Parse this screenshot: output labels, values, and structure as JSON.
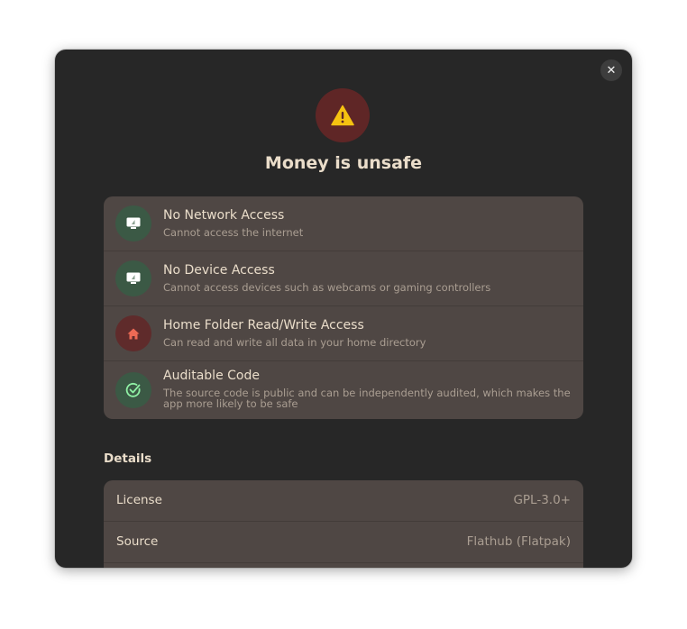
{
  "dialog": {
    "title": "Money is unsafe",
    "close_icon": "close-icon",
    "hero_icon": "warning-icon"
  },
  "permissions": [
    {
      "title": "No Network Access",
      "subtitle": "Cannot access the internet",
      "icon": "network-offline-icon",
      "tone": "green"
    },
    {
      "title": "No Device Access",
      "subtitle": "Cannot access devices such as webcams or gaming controllers",
      "icon": "device-offline-icon",
      "tone": "green"
    },
    {
      "title": "Home Folder Read/Write Access",
      "subtitle": "Can read and write all data in your home directory",
      "icon": "home-icon",
      "tone": "red"
    },
    {
      "title": "Auditable Code",
      "subtitle": "The source code is public and can be independently audited, which makes the app more likely to be safe",
      "icon": "check-circle-icon",
      "tone": "green"
    }
  ],
  "details": {
    "heading": "Details",
    "rows": [
      {
        "label": "License",
        "value": "GPL-3.0+"
      },
      {
        "label": "Source",
        "value": "Flathub (Flatpak)"
      }
    ]
  },
  "colors": {
    "window_bg": "#272727",
    "card_bg": "#4f4744",
    "text_primary": "#eaddca",
    "text_secondary": "#aa9e92",
    "safe_green": "#3b5945",
    "unsafe_red": "#5f2b2b",
    "warning_yellow": "#f5c211"
  }
}
